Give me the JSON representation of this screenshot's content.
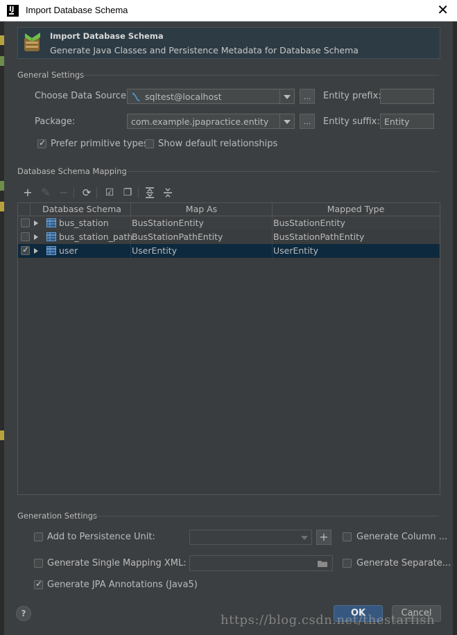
{
  "window": {
    "title": "Import Database Schema",
    "close_glyph": "✕"
  },
  "banner": {
    "title": "Import Database Schema",
    "subtitle": "Generate Java Classes and Persistence Metadata for Database Schema"
  },
  "general": {
    "section_title": "General Settings",
    "data_source_label": "Choose Data Source:",
    "data_source_value": "sqltest@localhost",
    "package_label": "Package:",
    "package_value": "com.example.jpapractice.entity",
    "browse_label": "...",
    "entity_prefix_label": "Entity prefix:",
    "entity_prefix_value": "",
    "entity_suffix_label": "Entity suffix:",
    "entity_suffix_value": "Entity",
    "prefer_primitive_label": "Prefer primitive types",
    "prefer_primitive_checked": true,
    "show_default_rel_label": "Show default relationships",
    "show_default_rel_checked": false
  },
  "mapping": {
    "section_title": "Database Schema Mapping",
    "columns": [
      "Database Schema",
      "Map As",
      "Mapped Type"
    ],
    "rows": [
      {
        "checked": false,
        "schema": "bus_station",
        "map_as": "BusStationEntity",
        "mapped_type": "BusStationEntity",
        "selected": false
      },
      {
        "checked": false,
        "schema": "bus_station_path",
        "map_as": "BusStationPathEntity",
        "mapped_type": "BusStationPathEntity",
        "selected": false
      },
      {
        "checked": true,
        "schema": "user",
        "map_as": "UserEntity",
        "mapped_type": "UserEntity",
        "selected": true
      }
    ],
    "toolbar_icons": [
      "add-icon",
      "edit-icon",
      "remove-icon",
      "refresh-icon",
      "check-all-icon",
      "copy-icon",
      "expand-all-icon",
      "collapse-all-icon"
    ]
  },
  "generation": {
    "section_title": "Generation Settings",
    "add_persistence_label": "Add to Persistence Unit:",
    "add_persistence_checked": false,
    "plus_label": "+",
    "generate_column_label": "Generate Column ...",
    "generate_column_checked": false,
    "single_mapping_label": "Generate Single Mapping XML:",
    "single_mapping_checked": false,
    "generate_separate_label": "Generate Separate...",
    "generate_separate_checked": false,
    "jpa_annotations_label": "Generate JPA Annotations (Java5)",
    "jpa_annotations_checked": true
  },
  "footer": {
    "help_label": "?",
    "ok_label": "OK",
    "cancel_label": "Cancel",
    "watermark": "https://blog.csdn.net/thestarfish"
  },
  "colors": {
    "background": "#3c3f41",
    "selection": "#0d293e",
    "primary_button": "#365880",
    "banner": "#2d3b44"
  }
}
